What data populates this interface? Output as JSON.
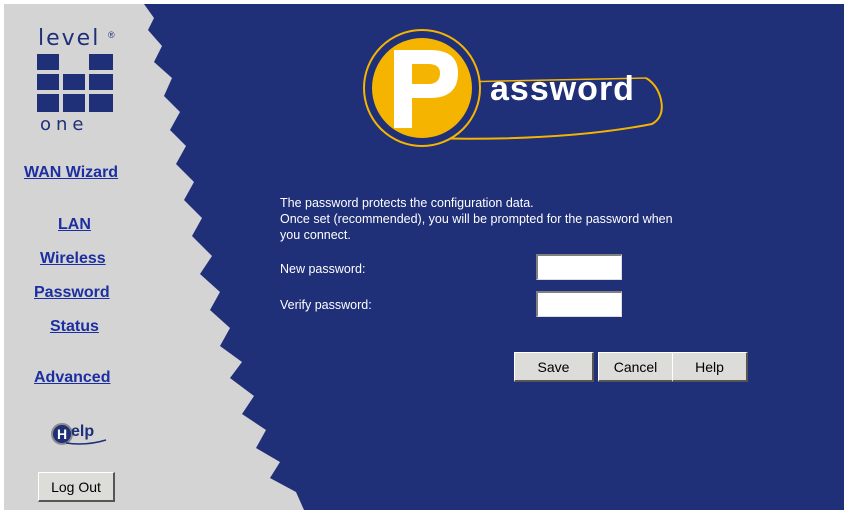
{
  "brand": {
    "top": "level",
    "bottom": "one",
    "reg_mark": "®"
  },
  "sidebar": {
    "wan_wizard": "WAN Wizard",
    "lan": "LAN",
    "wireless": "Wireless",
    "password": "Password",
    "status": "Status",
    "advanced": "Advanced",
    "help_badge": "elp",
    "logout": "Log Out"
  },
  "banner": {
    "letter": "P",
    "rest": "assword"
  },
  "main": {
    "desc_line1": "The password protects the configuration data.",
    "desc_line2": "Once set (recommended), you will be prompted for the password when",
    "desc_line3": "you connect.",
    "new_password_label": "New password:",
    "verify_password_label": "Verify password:",
    "new_password_value": "",
    "verify_password_value": ""
  },
  "buttons": {
    "save": "Save",
    "cancel": "Cancel",
    "help": "Help"
  },
  "colors": {
    "background_blue": "#1f2f78",
    "sidebar_grey": "#d4d4d4",
    "link_blue": "#1c2fa0",
    "logo_gold": "#f5b400"
  }
}
